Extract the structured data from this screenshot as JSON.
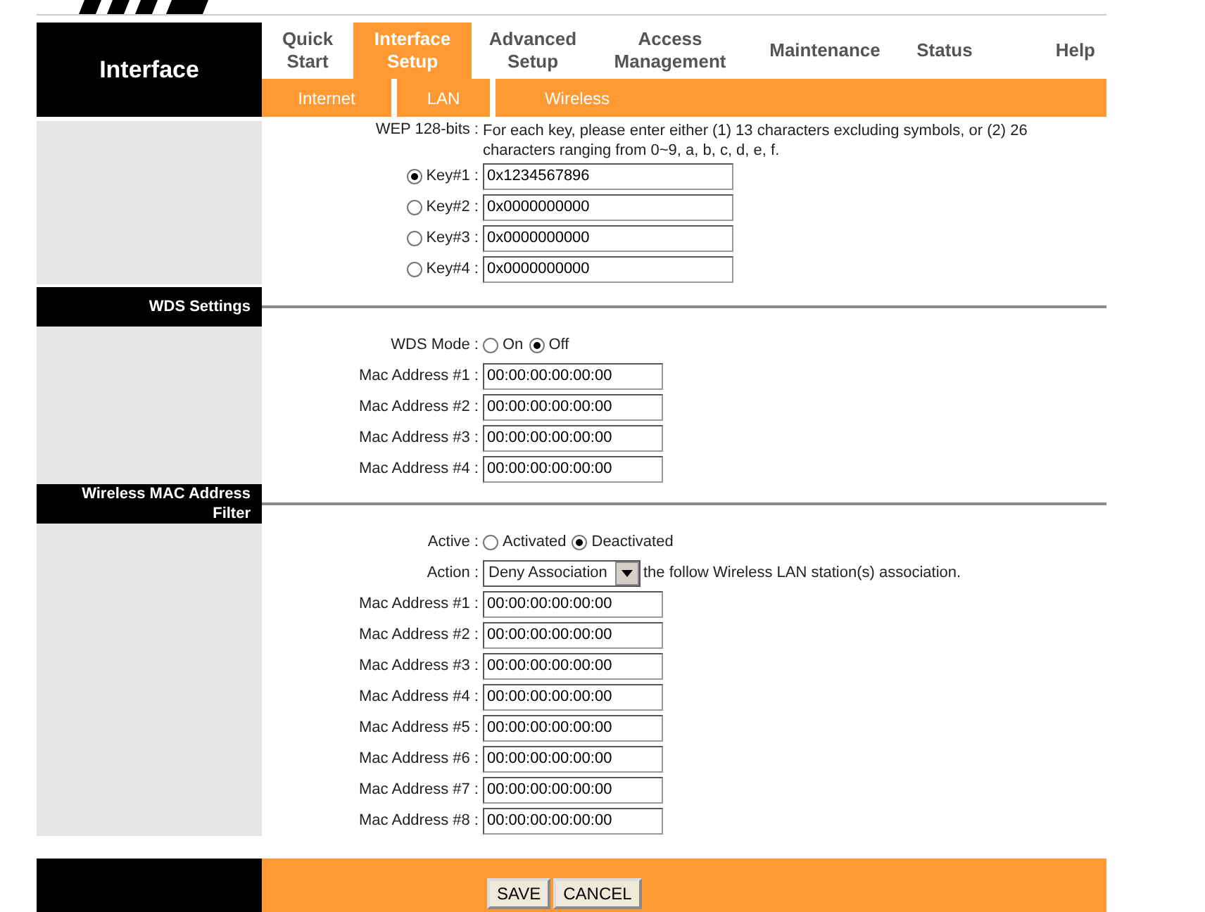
{
  "nav": {
    "section": "Interface",
    "tabs": [
      {
        "lines": [
          "Quick",
          "Start"
        ],
        "selected": false
      },
      {
        "lines": [
          "Interface",
          "Setup"
        ],
        "selected": true
      },
      {
        "lines": [
          "Advanced",
          "Setup"
        ],
        "selected": false
      },
      {
        "lines": [
          "Access",
          "Management"
        ],
        "selected": false
      },
      {
        "lines": [
          "Maintenance"
        ],
        "selected": false
      },
      {
        "lines": [
          "Status"
        ],
        "selected": false
      },
      {
        "lines": [
          "Help"
        ],
        "selected": false
      }
    ],
    "subtabs": [
      "Internet",
      "LAN",
      "Wireless"
    ]
  },
  "wep": {
    "label": "WEP 128-bits :",
    "note": "For each key, please enter either (1) 13 characters excluding symbols, or (2) 26 characters ranging from 0~9, a, b, c, d, e, f.",
    "keys": [
      {
        "label": "Key#1 :",
        "value": "0x1234567896",
        "selected": true
      },
      {
        "label": "Key#2 :",
        "value": "0x0000000000",
        "selected": false
      },
      {
        "label": "Key#3 :",
        "value": "0x0000000000",
        "selected": false
      },
      {
        "label": "Key#4 :",
        "value": "0x0000000000",
        "selected": false
      }
    ]
  },
  "wds": {
    "title": "WDS Settings",
    "mode": {
      "label": "WDS Mode :",
      "options": [
        {
          "label": "On",
          "selected": false
        },
        {
          "label": "Off",
          "selected": true
        }
      ]
    },
    "macs": [
      {
        "label": "Mac Address #1 :",
        "value": "00:00:00:00:00:00"
      },
      {
        "label": "Mac Address #2 :",
        "value": "00:00:00:00:00:00"
      },
      {
        "label": "Mac Address #3 :",
        "value": "00:00:00:00:00:00"
      },
      {
        "label": "Mac Address #4 :",
        "value": "00:00:00:00:00:00"
      }
    ]
  },
  "mac_filter": {
    "title": "Wireless MAC Address Filter",
    "active": {
      "label": "Active :",
      "options": [
        {
          "label": "Activated",
          "selected": false
        },
        {
          "label": "Deactivated",
          "selected": true
        }
      ]
    },
    "action": {
      "label": "Action :",
      "value": "Deny Association",
      "suffix": "the follow Wireless LAN station(s) association."
    },
    "macs": [
      {
        "label": "Mac Address #1 :",
        "value": "00:00:00:00:00:00"
      },
      {
        "label": "Mac Address #2 :",
        "value": "00:00:00:00:00:00"
      },
      {
        "label": "Mac Address #3 :",
        "value": "00:00:00:00:00:00"
      },
      {
        "label": "Mac Address #4 :",
        "value": "00:00:00:00:00:00"
      },
      {
        "label": "Mac Address #5 :",
        "value": "00:00:00:00:00:00"
      },
      {
        "label": "Mac Address #6 :",
        "value": "00:00:00:00:00:00"
      },
      {
        "label": "Mac Address #7 :",
        "value": "00:00:00:00:00:00"
      },
      {
        "label": "Mac Address #8 :",
        "value": "00:00:00:00:00:00"
      }
    ]
  },
  "buttons": [
    "SAVE",
    "CANCEL"
  ]
}
